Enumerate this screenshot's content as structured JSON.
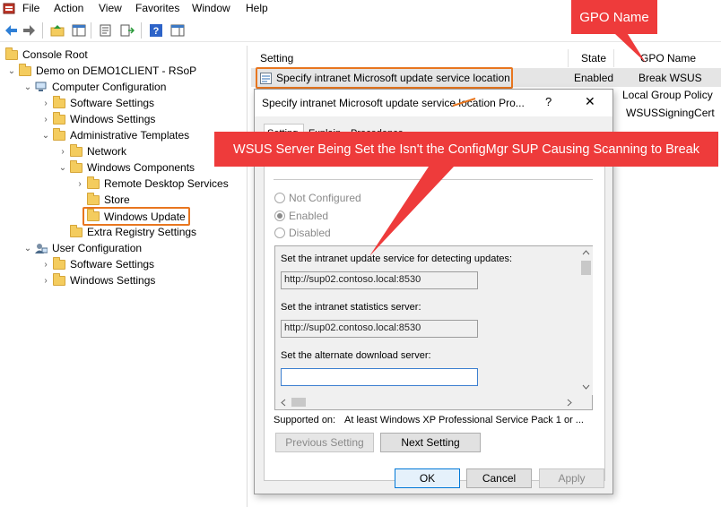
{
  "menu": [
    "File",
    "Action",
    "View",
    "Favorites",
    "Window",
    "Help"
  ],
  "tree": {
    "console_root": "Console Root",
    "rsop": "Demo on DEMO1CLIENT - RSoP",
    "computer_config": "Computer Configuration",
    "cc_software": "Software Settings",
    "cc_windows": "Windows Settings",
    "admin_templates": "Administrative Templates",
    "network": "Network",
    "windows_components": "Windows Components",
    "remote_desktop": "Remote Desktop Services",
    "store": "Store",
    "windows_update": "Windows Update",
    "extra_registry": "Extra Registry Settings",
    "user_config": "User Configuration",
    "uc_software": "Software Settings",
    "uc_windows": "Windows Settings"
  },
  "list": {
    "headers": {
      "setting": "Setting",
      "state": "State",
      "gpo_name": "GPO Name"
    },
    "row": {
      "setting": "Specify intranet Microsoft update service location",
      "state": "Enabled",
      "gpo": "Break WSUS"
    },
    "gpo_extra": [
      "Local Group Policy",
      "WSUSSigningCert"
    ]
  },
  "dialog": {
    "title": "Specify intranet Microsoft update service location Pro...",
    "help": "?",
    "close": "✕",
    "tabs": [
      "Setting",
      "Explain",
      "Precedence"
    ],
    "options": {
      "not_configured": "Not Configured",
      "enabled": "Enabled",
      "disabled": "Disabled"
    },
    "label_detect": "Set the intranet update service for detecting updates:",
    "value_detect": "http://sup02.contoso.local:8530",
    "label_stats": "Set the intranet statistics server:",
    "value_stats": "http://sup02.contoso.local:8530",
    "label_alt": "Set the alternate download server:",
    "value_alt": "",
    "supported_label": "Supported on:",
    "supported_value": "At least Windows XP Professional Service Pack 1 or ...",
    "prev": "Previous Setting",
    "next": "Next Setting",
    "ok": "OK",
    "cancel": "Cancel",
    "apply": "Apply"
  },
  "callouts": {
    "gpo": "GPO Name",
    "wsus": "WSUS Server Being Set the Isn't the ConfigMgr SUP Causing Scanning to Break"
  },
  "colors": {
    "callout": "#ee3b3b",
    "highlight": "#e8761f",
    "folder": "#f4cc5e"
  }
}
